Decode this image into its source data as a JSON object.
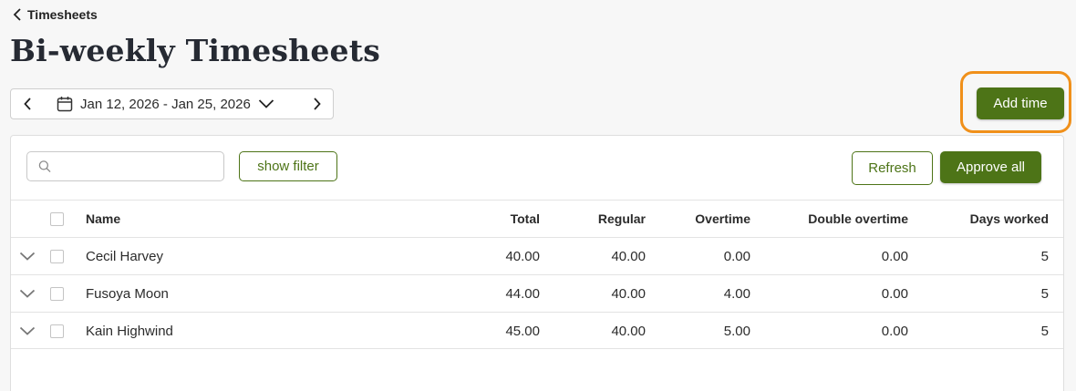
{
  "breadcrumb": {
    "label": "Timesheets"
  },
  "page": {
    "title": "Bi-weekly Timesheets"
  },
  "date_range": {
    "label": "Jan 12, 2026 - Jan 25, 2026"
  },
  "actions": {
    "add_time": "Add time"
  },
  "toolbar": {
    "search_placeholder": "",
    "show_filter": "show filter",
    "refresh": "Refresh",
    "approve_all": "Approve all"
  },
  "table": {
    "columns": {
      "name": "Name",
      "total": "Total",
      "regular": "Regular",
      "overtime": "Overtime",
      "double_overtime": "Double overtime",
      "days_worked": "Days worked"
    },
    "rows": [
      {
        "name": "Cecil Harvey",
        "total": "40.00",
        "regular": "40.00",
        "overtime": "0.00",
        "double_overtime": "0.00",
        "days_worked": "5"
      },
      {
        "name": "Fusoya Moon",
        "total": "44.00",
        "regular": "40.00",
        "overtime": "4.00",
        "double_overtime": "0.00",
        "days_worked": "5"
      },
      {
        "name": "Kain Highwind",
        "total": "45.00",
        "regular": "40.00",
        "overtime": "5.00",
        "double_overtime": "0.00",
        "days_worked": "5"
      }
    ]
  },
  "colors": {
    "primary": "#4d7417",
    "highlight_ring": "#f0901a",
    "page_background": "#f7f7f7"
  },
  "icons": {
    "back": "chevron-left-icon",
    "prev": "chevron-left-icon",
    "next": "chevron-right-icon",
    "calendar": "calendar-icon",
    "dropdown": "chevron-down-icon",
    "search": "search-icon",
    "row_expand": "chevron-down-icon"
  }
}
